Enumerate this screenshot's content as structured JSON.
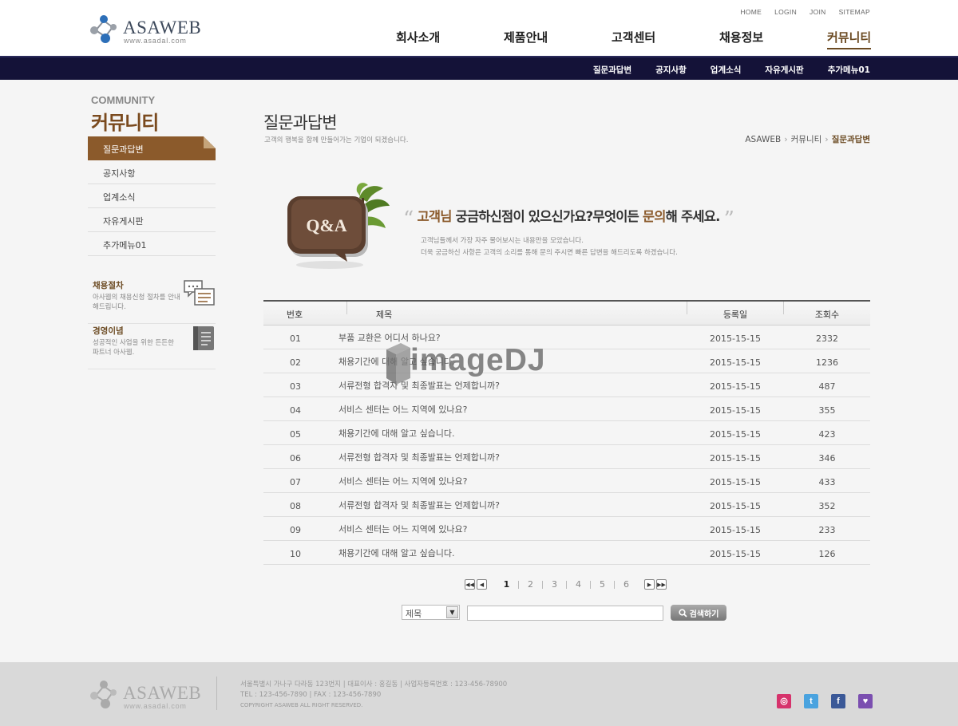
{
  "brand": {
    "name": "ASAWEB",
    "url": "www.asadal.com"
  },
  "util_links": [
    "HOME",
    "LOGIN",
    "JOIN",
    "SITEMAP"
  ],
  "gnb": [
    "회사소개",
    "제품안내",
    "고객센터",
    "채용정보",
    "커뮤니티"
  ],
  "subnav": [
    "질문과답변",
    "공지사항",
    "업계소식",
    "자유게시판",
    "추가메뉴01"
  ],
  "sidebar": {
    "eng": "COMMUNITY",
    "kor": "커뮤니티",
    "items": [
      "질문과답변",
      "공지사항",
      "업계소식",
      "자유게시판",
      "추가메뉴01"
    ],
    "box1": {
      "title": "채용절차",
      "desc": "아사웹의 채용신청 절차를 안내해드립니다."
    },
    "box2": {
      "title": "경영이념",
      "desc": "성공적인 사업을 위한 든든한 파트너 아사웹."
    }
  },
  "page": {
    "title": "질문과답변",
    "desc": "고객의 행복을 함께 만들어가는 기업이 되겠습니다.",
    "breadcrumb": [
      "ASAWEB",
      "커뮤니티",
      "질문과답변"
    ]
  },
  "intro": {
    "icon_label": "Q&A",
    "title_hl1": "고객님",
    "title_mid": " 궁금하신점이 있으신가요?무엇이든 ",
    "title_hl2": "문의",
    "title_end": "해 주세요.",
    "desc1": "고객님들께서 가장 자주 물어보시는 내용만을 모았습니다.",
    "desc2": "더욱 궁금하신 사항은 고객의 소리를 통해 문의 주시면 빠른 답변을 해드리도록 하겠습니다."
  },
  "board": {
    "headers": [
      "번호",
      "제목",
      "등록일",
      "조회수"
    ],
    "rows": [
      [
        "01",
        "부품 교환은 어디서 하나요?",
        "2015-15-15",
        "2332"
      ],
      [
        "02",
        "채용기간에 대해 알고 싶습니다.",
        "2015-15-15",
        "1236"
      ],
      [
        "03",
        "서류전형 합격자 및 최종발표는 언제합니까?",
        "2015-15-15",
        "487"
      ],
      [
        "04",
        "서비스 센터는 어느 지역에 있나요?",
        "2015-15-15",
        "355"
      ],
      [
        "05",
        "채용기간에 대해 알고 싶습니다.",
        "2015-15-15",
        "423"
      ],
      [
        "06",
        "서류전형 합격자 및 최종발표는 언제합니까?",
        "2015-15-15",
        "346"
      ],
      [
        "07",
        "서비스 센터는 어느 지역에 있나요?",
        "2015-15-15",
        "433"
      ],
      [
        "08",
        "서류전형 합격자 및 최종발표는 언제합니까?",
        "2015-15-15",
        "352"
      ],
      [
        "09",
        "서비스 센터는 어느 지역에 있나요?",
        "2015-15-15",
        "233"
      ],
      [
        "10",
        "채용기간에 대해 알고 싶습니다.",
        "2015-15-15",
        "126"
      ]
    ]
  },
  "pagination": {
    "pages": [
      "1",
      "2",
      "3",
      "4",
      "5",
      "6"
    ],
    "current": "1"
  },
  "search": {
    "select_value": "제목",
    "button_label": "검색하기"
  },
  "watermark": "imageDJ",
  "footer": {
    "address": "서울특별시 가나구 다라동 123번지  |  대표이사 : 홍길동  |  사업자등록번호 : 123-456-78900",
    "contact": "TEL : 123-456-7890  |  FAX : 123-456-7890",
    "copyright": "COPYRIGHT ASAWEB ALL RIGHT RESERVED.",
    "sns": [
      "instagram-icon",
      "twitter-icon",
      "facebook-icon",
      "blog-icon"
    ]
  },
  "colors": {
    "accent": "#8b5a2b",
    "subbar": "#141238",
    "footer": "#d9d9d9"
  }
}
